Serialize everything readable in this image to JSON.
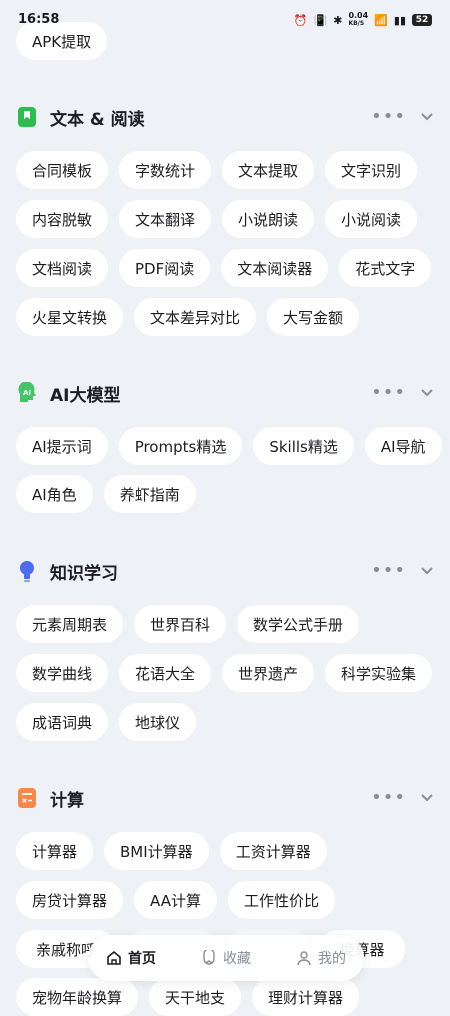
{
  "status": {
    "time": "16:58",
    "speed": "0.04",
    "speed_unit": "KB/S",
    "battery": "52"
  },
  "top_chip": "APK提取",
  "sections": [
    {
      "title": "文本 & 阅读",
      "rows": [
        [
          "合同模板",
          "字数统计",
          "文本提取",
          "文字识别"
        ],
        [
          "内容脱敏",
          "文本翻译",
          "小说朗读",
          "小说阅读"
        ],
        [
          "文档阅读",
          "PDF阅读",
          "文本阅读器",
          "花式文字"
        ],
        [
          "火星文转换",
          "文本差异对比",
          "大写金额"
        ]
      ]
    },
    {
      "title": "AI大模型",
      "rows": [
        [
          "AI提示词",
          "Prompts精选",
          "Skills精选",
          "AI导航"
        ],
        [
          "AI角色",
          "养虾指南"
        ]
      ]
    },
    {
      "title": "知识学习",
      "rows": [
        [
          "元素周期表",
          "世界百科",
          "数学公式手册"
        ],
        [
          "数学曲线",
          "花语大全",
          "世界遗产",
          "科学实验集"
        ],
        [
          "成语词典",
          "地球仪"
        ]
      ]
    },
    {
      "title": "计算",
      "rows": [
        [
          "计算器",
          "BMI计算器",
          "工资计算器"
        ],
        [
          "房贷计算器",
          "AA计算",
          "工作性价比"
        ],
        [
          "亲戚称呼",
          "",
          "",
          "换算器"
        ],
        [
          "宠物年龄换算",
          "天干地支",
          "理财计算器"
        ]
      ]
    }
  ],
  "nav": {
    "home": "首页",
    "favorites": "收藏",
    "mine": "我的"
  },
  "colors": {
    "background": "#eef1f6",
    "text_green": "#2dbd4e",
    "ai_green": "#45c46a",
    "bulb_blue": "#4b6cf0",
    "calc_orange": "#f7884a"
  }
}
